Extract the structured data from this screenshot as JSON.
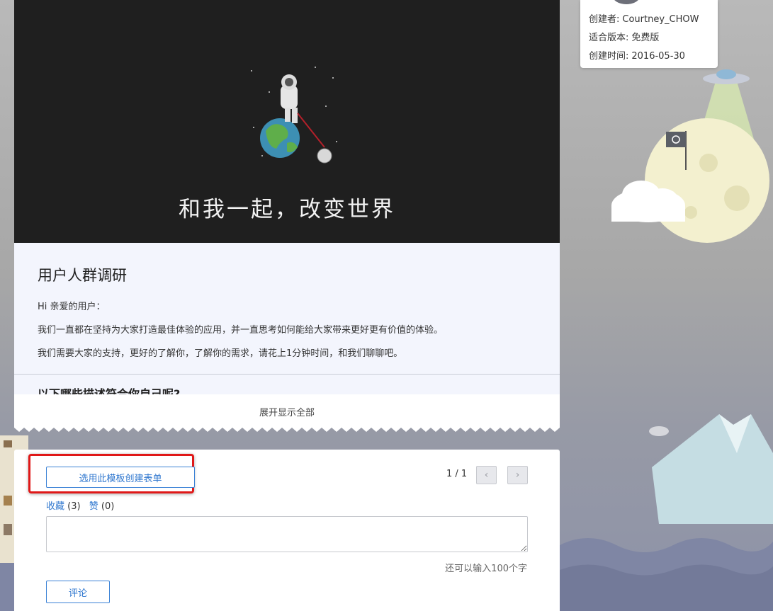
{
  "meta": {
    "creator_label": "创建者:",
    "creator_value": "Courtney_CHOW",
    "version_label": "适合版本:",
    "version_value": "免费版",
    "created_label": "创建时间:",
    "created_value": "2016-05-30"
  },
  "banner": {
    "title": "和我一起，改变世界"
  },
  "form": {
    "title": "用户人群调研",
    "greeting": "Hi 亲爱的用户：",
    "paragraph1": "我们一直都在坚持为大家打造最佳体验的应用，并一直思考如何能给大家带来更好更有价值的体验。",
    "paragraph2": "我们需要大家的支持，更好的了解你，了解你的需求，请花上1分钟时间，和我们聊聊吧。",
    "question1": "以下哪些描述符合你自己呢?"
  },
  "expand": {
    "label": "展开显示全部"
  },
  "actions": {
    "use_template_label": "选用此模板创建表单",
    "pager": "1 / 1",
    "prev_icon": "‹",
    "next_icon": "›",
    "favorite_label": "收藏",
    "favorite_count": "(3)",
    "like_label": "赞",
    "like_count": "(0)",
    "comment_placeholder": "",
    "chars_left": "还可以输入100个字",
    "comment_button_label": "评论"
  },
  "colors": {
    "accent": "#2f77cf",
    "highlight": "#e01818",
    "banner_bg": "#1f1f1f",
    "form_bg": "#f3f5fd"
  }
}
